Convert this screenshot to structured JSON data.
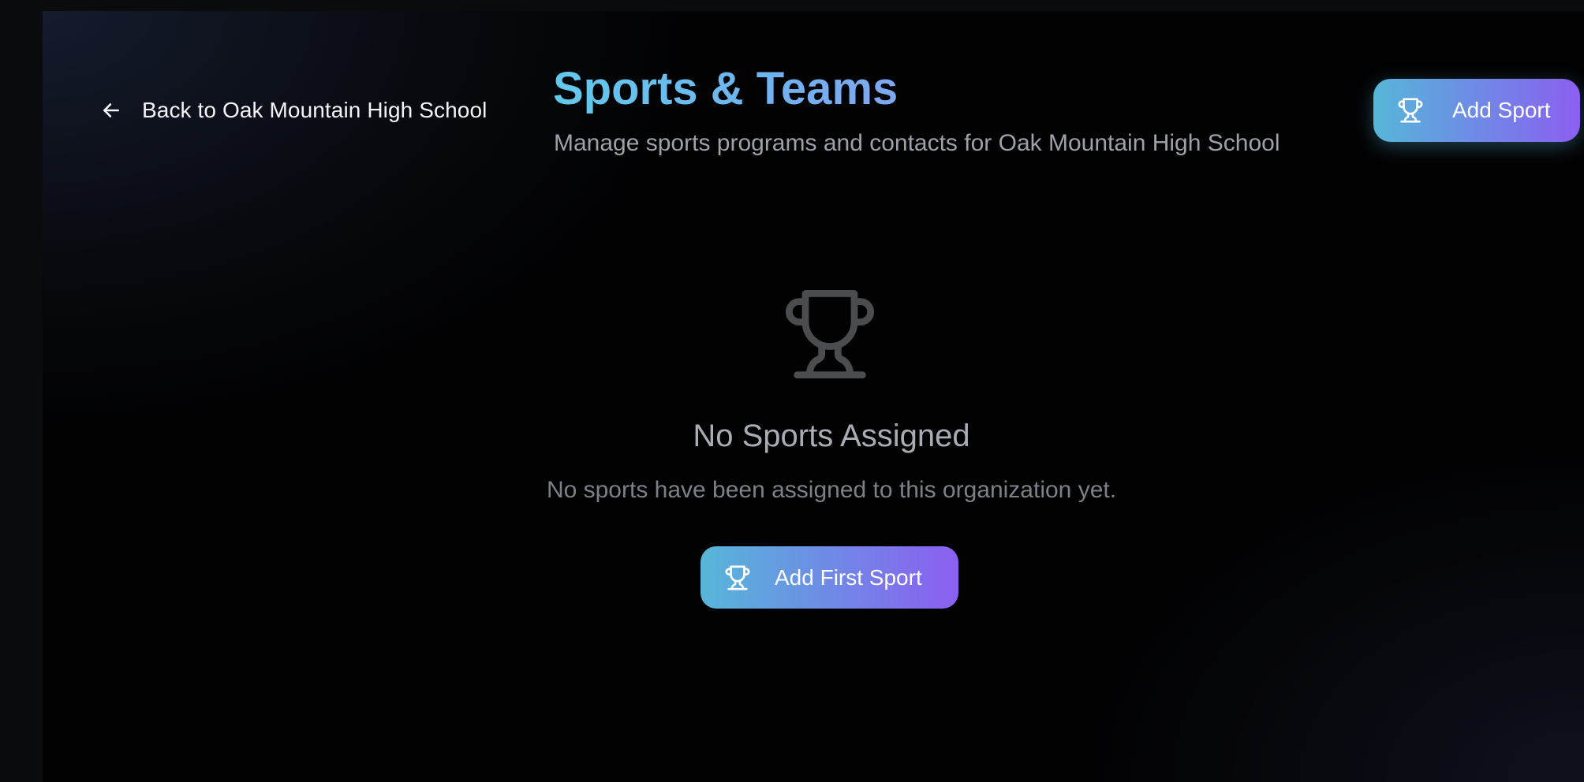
{
  "header": {
    "back_link_label": "Back to Oak Mountain High School",
    "title": "Sports & Teams",
    "subtitle": "Manage sports programs and contacts for Oak Mountain High School",
    "add_sport_label": "Add Sport"
  },
  "empty_state": {
    "icon": "trophy-icon",
    "title": "No Sports Assigned",
    "message": "No sports have been assigned to this organization yet.",
    "cta_label": "Add First Sport"
  },
  "colors": {
    "title_gradient_start": "#62c9ea",
    "button_gradient_start": "#56b7d8",
    "button_gradient_end": "#8b5ff0",
    "background": "#020203"
  }
}
